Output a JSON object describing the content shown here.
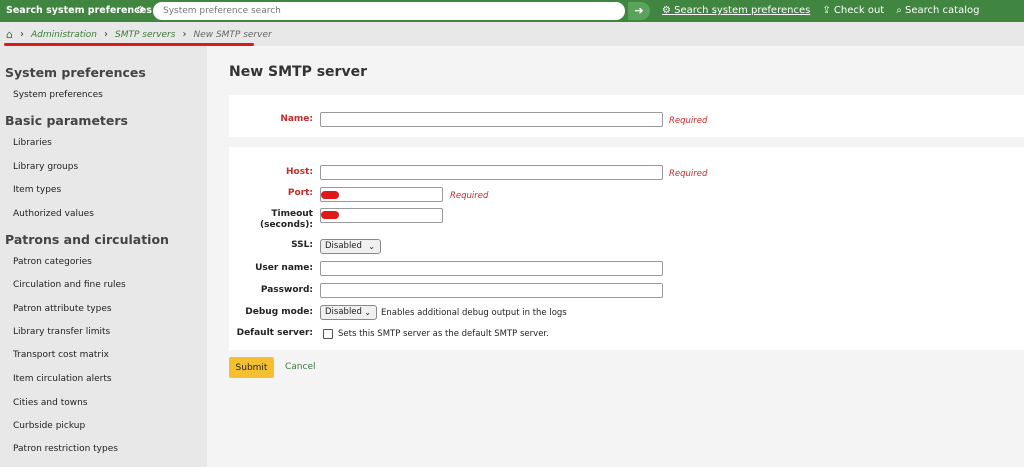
{
  "topbar": {
    "search_label": "Search system preferences",
    "search_placeholder": "System preference search",
    "links": [
      {
        "icon": "gears-icon",
        "label": "Search system preferences"
      },
      {
        "icon": "upload-icon",
        "label": "Check out"
      },
      {
        "icon": "search-icon",
        "label": "Search catalog"
      }
    ]
  },
  "breadcrumb": {
    "items": [
      "Administration",
      "SMTP servers"
    ],
    "current": "New SMTP server"
  },
  "sidebar": {
    "sections": [
      {
        "heading": "System preferences",
        "items": [
          "System preferences"
        ]
      },
      {
        "heading": "Basic parameters",
        "items": [
          "Libraries",
          "Library groups",
          "Item types",
          "Authorized values"
        ]
      },
      {
        "heading": "Patrons and circulation",
        "items": [
          "Patron categories",
          "Circulation and fine rules",
          "Patron attribute types",
          "Library transfer limits",
          "Transport cost matrix",
          "Item circulation alerts",
          "Cities and towns",
          "Curbside pickup",
          "Patron restriction types"
        ]
      }
    ]
  },
  "form": {
    "title": "New SMTP server",
    "required_note": "Required",
    "name_label": "Name:",
    "host_label": "Host:",
    "port_label": "Port:",
    "timeout_label_1": "Timeout",
    "timeout_label_2": "(seconds):",
    "ssl_label": "SSL:",
    "ssl_value": "Disabled",
    "username_label": "User name:",
    "password_label": "Password:",
    "debug_label": "Debug mode:",
    "debug_value": "Disabled",
    "debug_help": "Enables additional debug output in the logs",
    "default_label": "Default server:",
    "default_help": "Sets this SMTP server as the default SMTP server.",
    "submit_label": "Submit",
    "cancel_label": "Cancel"
  },
  "colors": {
    "brand_green": "#408540",
    "required_red": "#c52b2b",
    "submit_yellow": "#f5c02f"
  }
}
